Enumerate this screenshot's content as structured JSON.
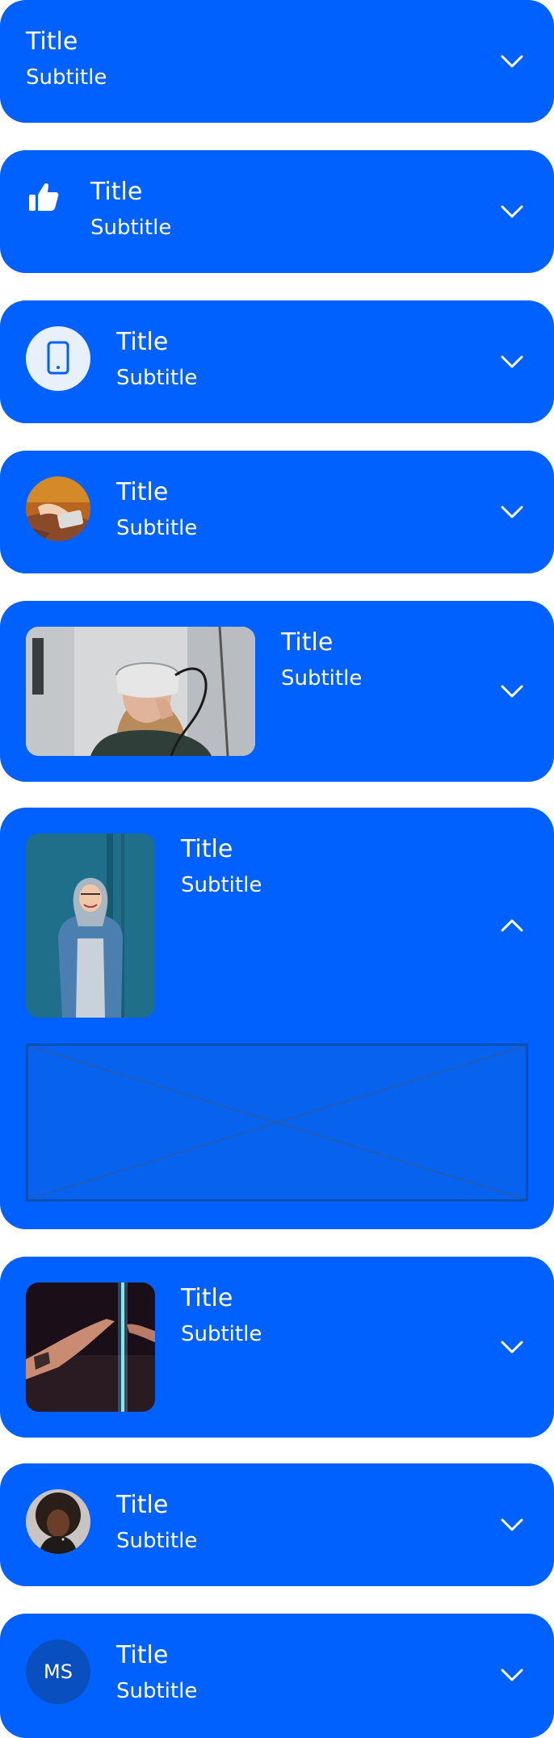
{
  "accent_color": "#0061fe",
  "cards": [
    {
      "title": "Title",
      "subtitle": "Subtitle",
      "leading": "none",
      "chevron": "chevron-down-icon"
    },
    {
      "title": "Title",
      "subtitle": "Subtitle",
      "leading": "thumbs-up-icon",
      "chevron": "chevron-down-icon"
    },
    {
      "title": "Title",
      "subtitle": "Subtitle",
      "leading": "smartphone-icon",
      "chevron": "chevron-down-icon"
    },
    {
      "title": "Title",
      "subtitle": "Subtitle",
      "leading": "avatar-photo",
      "chevron": "chevron-down-icon"
    },
    {
      "title": "Title",
      "subtitle": "Subtitle",
      "leading": "vr-headset-photo",
      "chevron": "chevron-down-icon"
    },
    {
      "title": "Title",
      "subtitle": "Subtitle",
      "leading": "person-in-hoodie-photo",
      "chevron": "chevron-up-icon",
      "expanded": true
    },
    {
      "title": "Title",
      "subtitle": "Subtitle",
      "leading": "hands-neon-photo",
      "chevron": "chevron-down-icon"
    },
    {
      "title": "Title",
      "subtitle": "Subtitle",
      "leading": "portrait-avatar-photo",
      "chevron": "chevron-down-icon"
    },
    {
      "title": "Title",
      "subtitle": "Subtitle",
      "leading": "initials-avatar",
      "initials": "MS",
      "chevron": "chevron-down-icon"
    }
  ]
}
